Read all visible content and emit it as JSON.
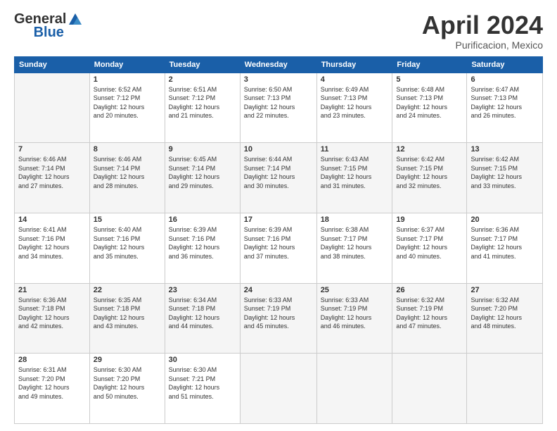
{
  "header": {
    "logo_general": "General",
    "logo_blue": "Blue",
    "month": "April 2024",
    "location": "Purificacion, Mexico"
  },
  "days_of_week": [
    "Sunday",
    "Monday",
    "Tuesday",
    "Wednesday",
    "Thursday",
    "Friday",
    "Saturday"
  ],
  "weeks": [
    [
      {
        "num": "",
        "info": ""
      },
      {
        "num": "1",
        "info": "Sunrise: 6:52 AM\nSunset: 7:12 PM\nDaylight: 12 hours\nand 20 minutes."
      },
      {
        "num": "2",
        "info": "Sunrise: 6:51 AM\nSunset: 7:12 PM\nDaylight: 12 hours\nand 21 minutes."
      },
      {
        "num": "3",
        "info": "Sunrise: 6:50 AM\nSunset: 7:13 PM\nDaylight: 12 hours\nand 22 minutes."
      },
      {
        "num": "4",
        "info": "Sunrise: 6:49 AM\nSunset: 7:13 PM\nDaylight: 12 hours\nand 23 minutes."
      },
      {
        "num": "5",
        "info": "Sunrise: 6:48 AM\nSunset: 7:13 PM\nDaylight: 12 hours\nand 24 minutes."
      },
      {
        "num": "6",
        "info": "Sunrise: 6:47 AM\nSunset: 7:13 PM\nDaylight: 12 hours\nand 26 minutes."
      }
    ],
    [
      {
        "num": "7",
        "info": "Sunrise: 6:46 AM\nSunset: 7:14 PM\nDaylight: 12 hours\nand 27 minutes."
      },
      {
        "num": "8",
        "info": "Sunrise: 6:46 AM\nSunset: 7:14 PM\nDaylight: 12 hours\nand 28 minutes."
      },
      {
        "num": "9",
        "info": "Sunrise: 6:45 AM\nSunset: 7:14 PM\nDaylight: 12 hours\nand 29 minutes."
      },
      {
        "num": "10",
        "info": "Sunrise: 6:44 AM\nSunset: 7:14 PM\nDaylight: 12 hours\nand 30 minutes."
      },
      {
        "num": "11",
        "info": "Sunrise: 6:43 AM\nSunset: 7:15 PM\nDaylight: 12 hours\nand 31 minutes."
      },
      {
        "num": "12",
        "info": "Sunrise: 6:42 AM\nSunset: 7:15 PM\nDaylight: 12 hours\nand 32 minutes."
      },
      {
        "num": "13",
        "info": "Sunrise: 6:42 AM\nSunset: 7:15 PM\nDaylight: 12 hours\nand 33 minutes."
      }
    ],
    [
      {
        "num": "14",
        "info": "Sunrise: 6:41 AM\nSunset: 7:16 PM\nDaylight: 12 hours\nand 34 minutes."
      },
      {
        "num": "15",
        "info": "Sunrise: 6:40 AM\nSunset: 7:16 PM\nDaylight: 12 hours\nand 35 minutes."
      },
      {
        "num": "16",
        "info": "Sunrise: 6:39 AM\nSunset: 7:16 PM\nDaylight: 12 hours\nand 36 minutes."
      },
      {
        "num": "17",
        "info": "Sunrise: 6:39 AM\nSunset: 7:16 PM\nDaylight: 12 hours\nand 37 minutes."
      },
      {
        "num": "18",
        "info": "Sunrise: 6:38 AM\nSunset: 7:17 PM\nDaylight: 12 hours\nand 38 minutes."
      },
      {
        "num": "19",
        "info": "Sunrise: 6:37 AM\nSunset: 7:17 PM\nDaylight: 12 hours\nand 40 minutes."
      },
      {
        "num": "20",
        "info": "Sunrise: 6:36 AM\nSunset: 7:17 PM\nDaylight: 12 hours\nand 41 minutes."
      }
    ],
    [
      {
        "num": "21",
        "info": "Sunrise: 6:36 AM\nSunset: 7:18 PM\nDaylight: 12 hours\nand 42 minutes."
      },
      {
        "num": "22",
        "info": "Sunrise: 6:35 AM\nSunset: 7:18 PM\nDaylight: 12 hours\nand 43 minutes."
      },
      {
        "num": "23",
        "info": "Sunrise: 6:34 AM\nSunset: 7:18 PM\nDaylight: 12 hours\nand 44 minutes."
      },
      {
        "num": "24",
        "info": "Sunrise: 6:33 AM\nSunset: 7:19 PM\nDaylight: 12 hours\nand 45 minutes."
      },
      {
        "num": "25",
        "info": "Sunrise: 6:33 AM\nSunset: 7:19 PM\nDaylight: 12 hours\nand 46 minutes."
      },
      {
        "num": "26",
        "info": "Sunrise: 6:32 AM\nSunset: 7:19 PM\nDaylight: 12 hours\nand 47 minutes."
      },
      {
        "num": "27",
        "info": "Sunrise: 6:32 AM\nSunset: 7:20 PM\nDaylight: 12 hours\nand 48 minutes."
      }
    ],
    [
      {
        "num": "28",
        "info": "Sunrise: 6:31 AM\nSunset: 7:20 PM\nDaylight: 12 hours\nand 49 minutes."
      },
      {
        "num": "29",
        "info": "Sunrise: 6:30 AM\nSunset: 7:20 PM\nDaylight: 12 hours\nand 50 minutes."
      },
      {
        "num": "30",
        "info": "Sunrise: 6:30 AM\nSunset: 7:21 PM\nDaylight: 12 hours\nand 51 minutes."
      },
      {
        "num": "",
        "info": ""
      },
      {
        "num": "",
        "info": ""
      },
      {
        "num": "",
        "info": ""
      },
      {
        "num": "",
        "info": ""
      }
    ]
  ]
}
